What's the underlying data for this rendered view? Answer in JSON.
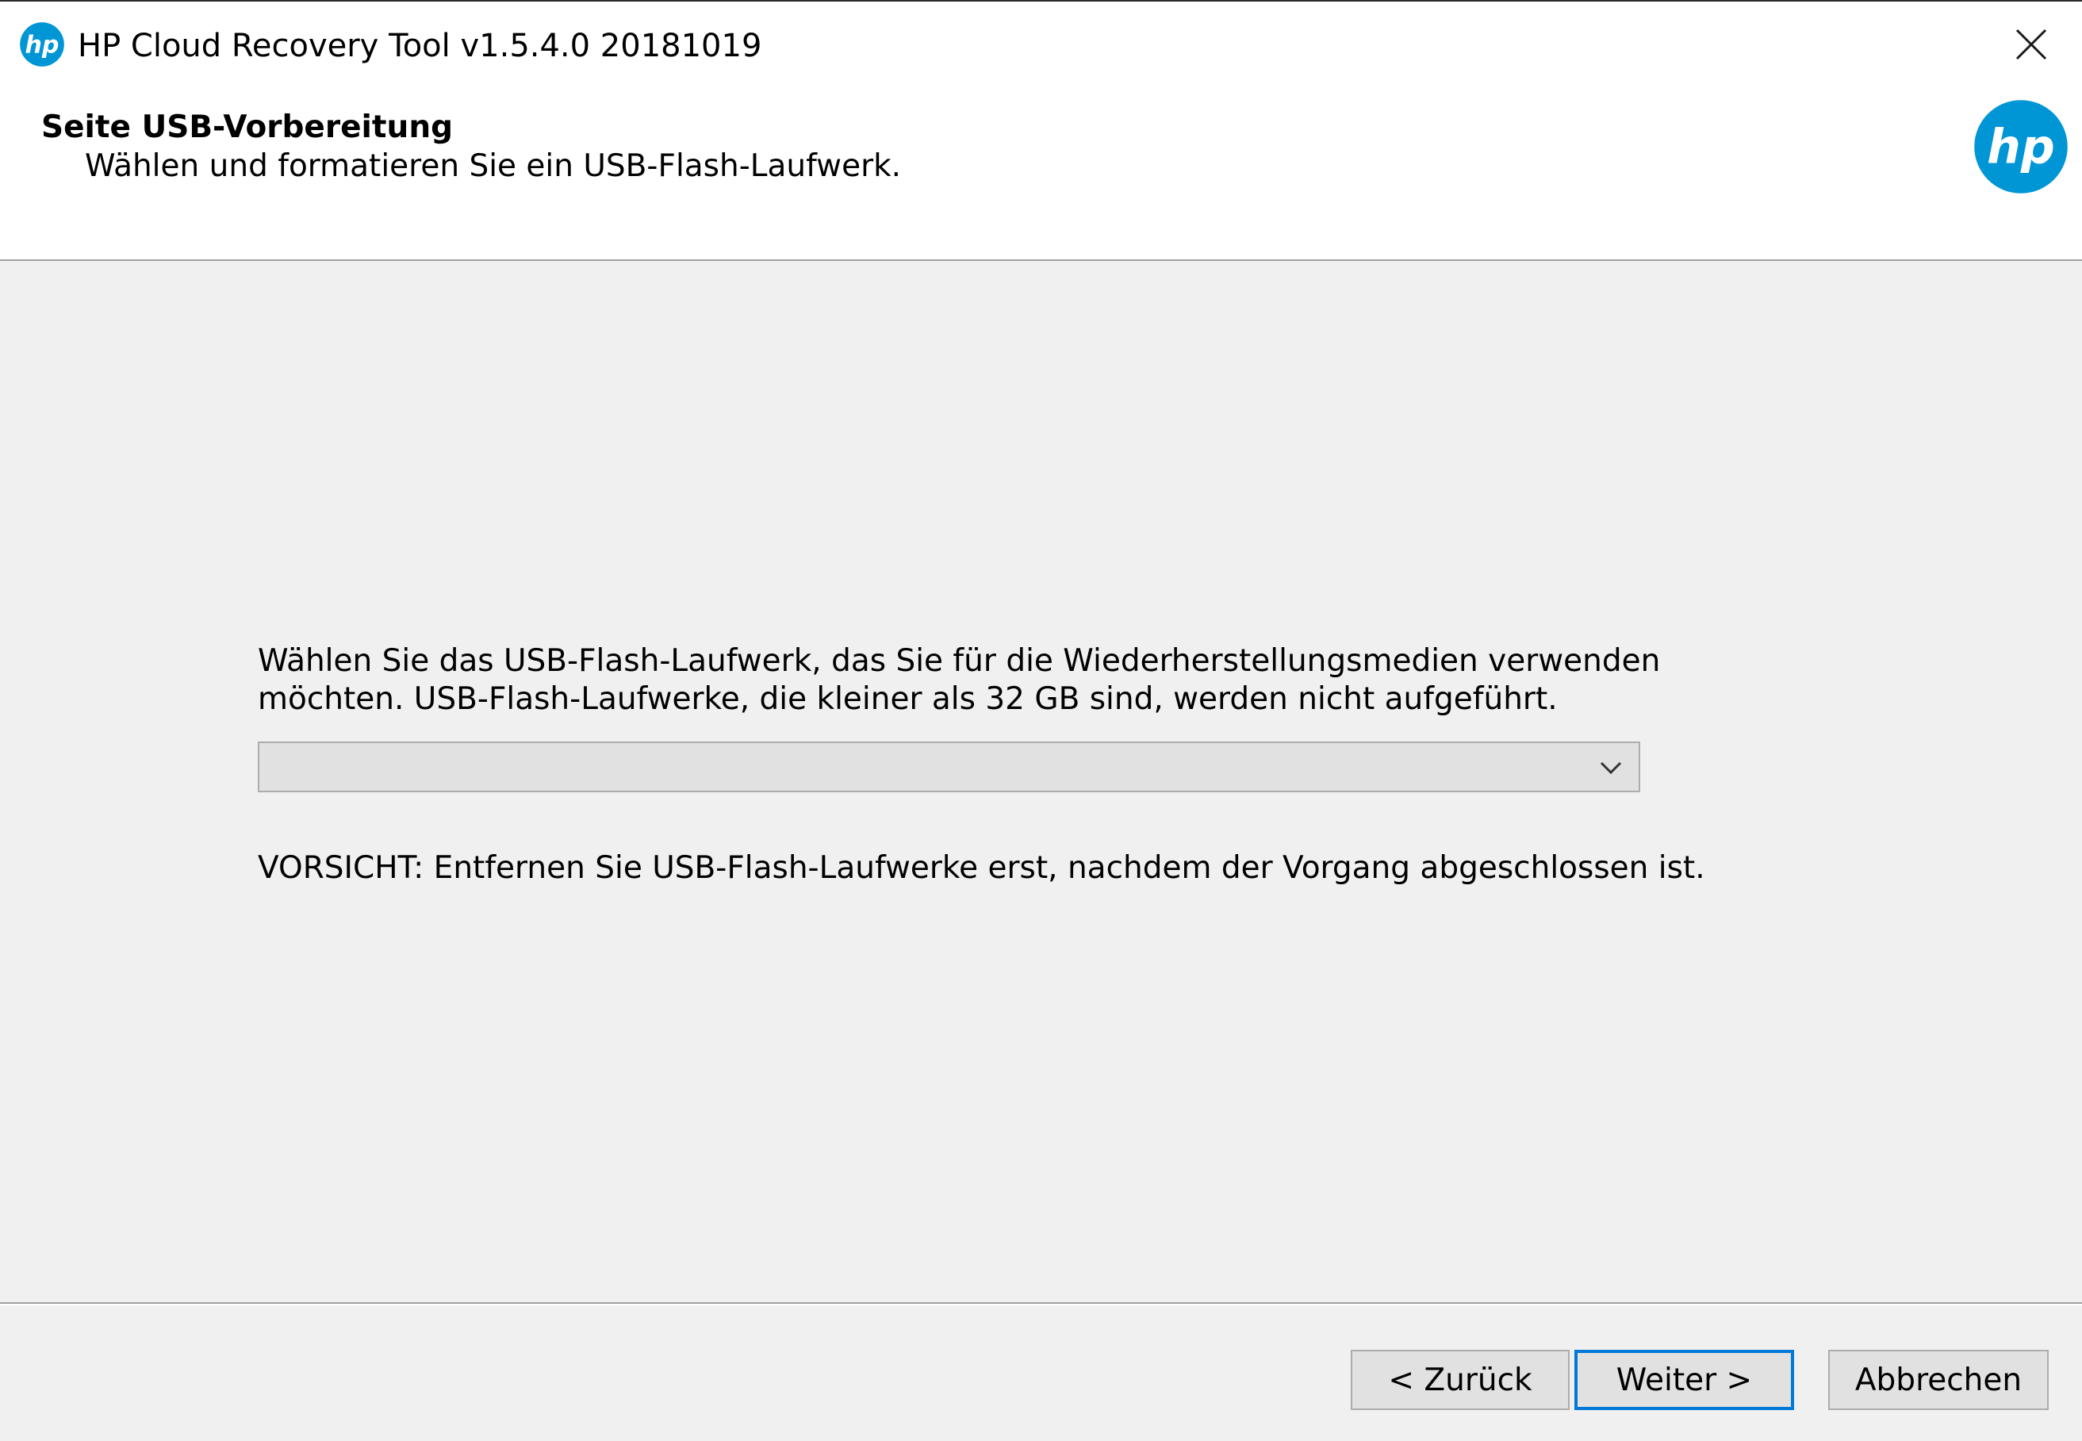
{
  "window": {
    "title": "HP Cloud Recovery Tool v1.5.4.0 20181019",
    "app_icon": "hp-logo-icon",
    "close_icon": "close-icon"
  },
  "header": {
    "heading": "Seite USB-Vorbereitung",
    "subheading": "Wählen und formatieren Sie ein USB-Flash-Laufwerk.",
    "logo": "hp-logo-icon",
    "logo_color": "#0096d6"
  },
  "main": {
    "instruction_line1": "Wählen Sie das USB-Flash-Laufwerk, das Sie für die Wiederherstellungsmedien verwenden",
    "instruction_line2": "möchten. USB-Flash-Laufwerke, die kleiner als 32 GB sind, werden nicht aufgeführt.",
    "drive_select": {
      "selected_value": "",
      "icon": "chevron-down-icon"
    },
    "caution": "VORSICHT: Entfernen Sie USB-Flash-Laufwerke erst, nachdem der Vorgang abgeschlossen ist."
  },
  "footer": {
    "back_label": "< Zurück",
    "next_label": "Weiter >",
    "cancel_label": "Abbrechen",
    "focus_color": "#0078d7"
  }
}
